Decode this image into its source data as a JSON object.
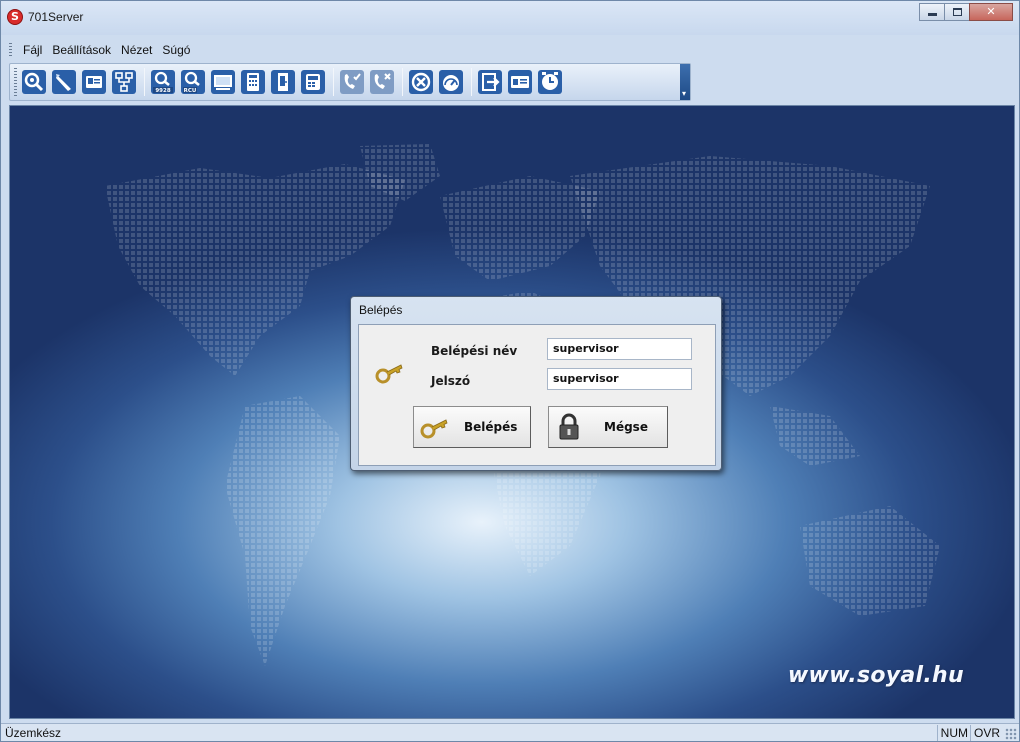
{
  "window": {
    "title": "701Server",
    "app_icon_letter": "S"
  },
  "menu": {
    "items": [
      "Fájl",
      "Beállítások",
      "Nézet",
      "Súgó"
    ]
  },
  "toolbar": {
    "buttons": [
      "magnifier-gear-icon",
      "pen-icon",
      "id-card-icon",
      "network-icon",
      "magnifier-9928-icon",
      "magnifier-rcu-icon",
      "display-icon",
      "calculator-icon",
      "door-icon",
      "controller-icon",
      "phone-check-icon",
      "phone-x-icon",
      "circle-x-icon",
      "gauge-icon",
      "exit-icon",
      "card-icon",
      "clock-icon"
    ],
    "badges": {
      "magnifier-9928-icon": "9928",
      "magnifier-rcu-icon": "RCU"
    }
  },
  "watermark": "www.soyal.hu",
  "login_dialog": {
    "title": "Belépés",
    "username_label": "Belépési név",
    "username_value": "supervisor",
    "password_label": "Jelszó",
    "password_value": "supervisor",
    "login_button": "Belépés",
    "cancel_button": "Mégse"
  },
  "status": {
    "text": "Üzemkész",
    "indicators": [
      "NUM",
      "OVR"
    ]
  },
  "colors": {
    "toolbar_icon_blue": "#2a5fa8",
    "background_dark": "#1c3468",
    "background_light": "#e8f2fb",
    "key_gold": "#c9a227"
  }
}
